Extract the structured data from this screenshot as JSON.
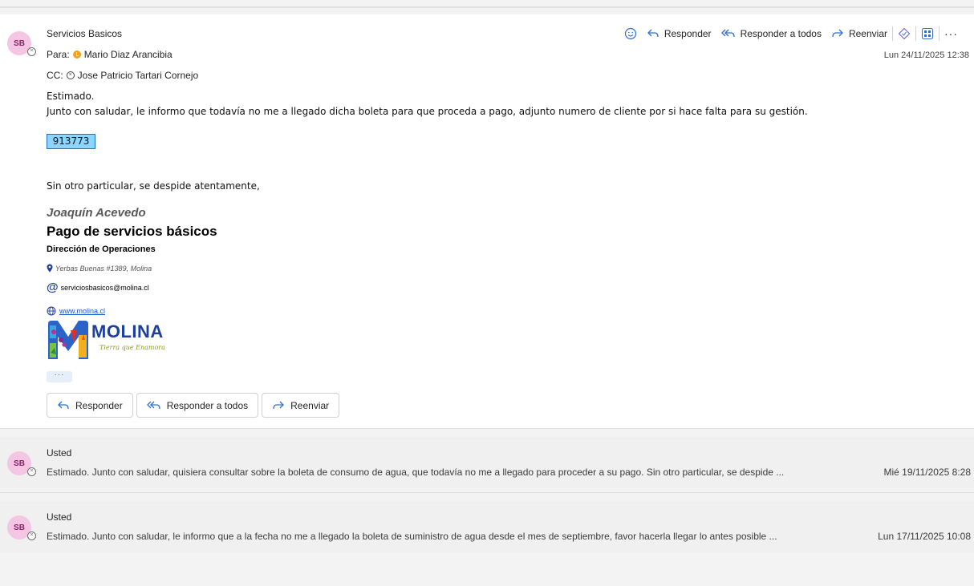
{
  "message": {
    "avatar_initials": "SB",
    "sender": "Servicios Basicos",
    "to_label": "Para:",
    "to_name": "Mario Diaz Arancibia",
    "cc_label": "CC:",
    "cc_name": "Jose Patricio Tartari Cornejo",
    "date": "Lun 24/11/2025 12:38",
    "toolbar": {
      "reply": "Responder",
      "reply_all": "Responder a todos",
      "forward": "Reenviar"
    },
    "greeting": "Estimado.",
    "body": "Junto con saludar, le informo que todavía no me a llegado dicha boleta para que proceda a pago, adjunto numero de cliente por si hace falta para su gestión.",
    "client_number": "913773",
    "closing": "Sin otro particular, se despide atentamente,",
    "signature": {
      "name": "Joaquín Acevedo",
      "title": "Pago de servicios básicos",
      "department": "Dirección de Operaciones",
      "address": "Yerbas Buenas #1389, Molina",
      "email": "serviciosbasicos@molina.cl",
      "website": "www.molina.cl",
      "logo_text": "MOLINA",
      "logo_tagline": "Tierra que Enamora"
    },
    "more": "···",
    "buttons": {
      "reply": "Responder",
      "reply_all": "Responder a todos",
      "forward": "Reenviar"
    }
  },
  "threads": [
    {
      "avatar_initials": "SB",
      "who": "Usted",
      "preview": "Estimado. Junto con saludar, quisiera consultar sobre la boleta de consumo de agua, que todavía no me a llegado para proceder a su pago. Sin otro particular, se despide ...",
      "date": "Mié 19/11/2025 8:28"
    },
    {
      "avatar_initials": "SB",
      "who": "Usted",
      "preview": "Estimado. Junto con saludar, le informo que a la fecha no me a llegado la boleta de suministro de agua desde el mes de septiembre, favor hacerla llegar lo antes posible ...",
      "date": "Lun 17/11/2025 10:08"
    }
  ]
}
